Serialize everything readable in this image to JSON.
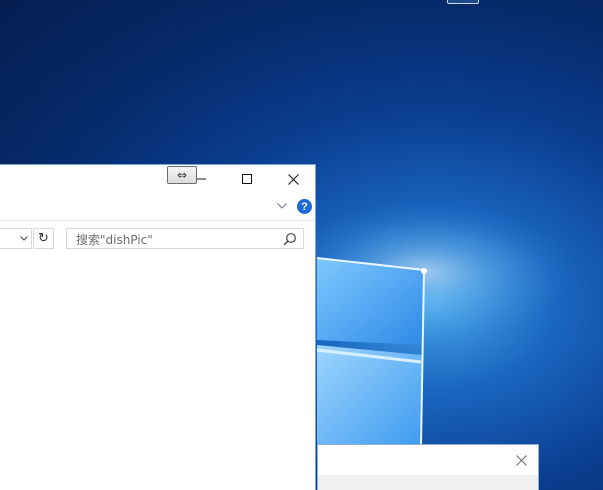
{
  "explorer": {
    "titlebar": {
      "minimize_icon": "minimize-icon",
      "maximize_icon": "maximize-icon",
      "close_icon": "close-icon",
      "resize_tooltip": "⇔"
    },
    "ribbon": {
      "expand_icon": "chevron-down-icon",
      "help_label": "?"
    },
    "address": {
      "dropdown_icon": "chevron-down-icon",
      "refresh_icon": "refresh-icon"
    },
    "search": {
      "placeholder": "搜索\"dishPic\"",
      "icon": "search-icon"
    }
  },
  "dialog": {
    "close_icon": "close-icon"
  },
  "colors": {
    "desktop_blue": "#0a3d8f",
    "accent": "#1b6ad8"
  }
}
